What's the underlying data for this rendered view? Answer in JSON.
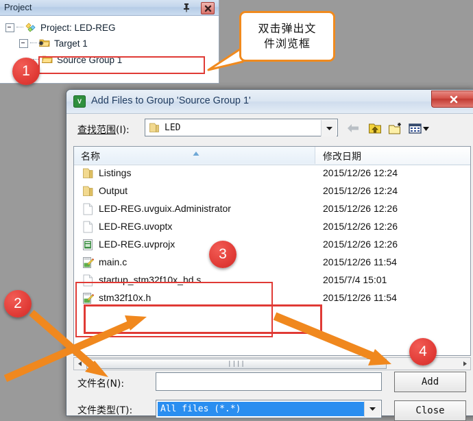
{
  "project_panel": {
    "title": "Project",
    "pin_icon": "pin-icon",
    "close_icon": "close-icon",
    "tree": [
      {
        "label": "Project: LED-REG",
        "icon": "project-icon",
        "expander": "minus"
      },
      {
        "label": "Target 1",
        "icon": "target-folder-icon",
        "expander": "minus"
      },
      {
        "label": "Source Group 1",
        "icon": "folder-icon",
        "expander": "none"
      }
    ]
  },
  "callout": {
    "text_line1": "双击弹出文",
    "text_line2": "件浏览框",
    "border_color": "#f08a1e"
  },
  "dialog": {
    "title": "Add Files to Group 'Source Group 1'",
    "app_icon": "uvision-icon",
    "close_icon": "close-icon",
    "lookin": {
      "label_main": "查找范围",
      "label_accel": "(I):",
      "value": "LED",
      "folder_icon": "folder-icon",
      "dropdown_icon": "chevron-down-icon"
    },
    "toolbar": [
      {
        "name": "back-button",
        "icon": "back-arrow-icon"
      },
      {
        "name": "up-folder-button",
        "icon": "up-folder-icon"
      },
      {
        "name": "new-folder-button",
        "icon": "new-folder-icon"
      },
      {
        "name": "views-button",
        "icon": "views-icon"
      }
    ],
    "list": {
      "columns": [
        "名称",
        "修改日期"
      ],
      "sort_indicator": "sort-asc-icon",
      "rows": [
        {
          "name": "Listings",
          "date": "2015/12/26 12:24",
          "icon": "folder-icon"
        },
        {
          "name": "Output",
          "date": "2015/12/26 12:24",
          "icon": "folder-icon"
        },
        {
          "name": "LED-REG.uvguix.Administrator",
          "date": "2015/12/26 12:26",
          "icon": "file-icon"
        },
        {
          "name": "LED-REG.uvoptx",
          "date": "2015/12/26 12:26",
          "icon": "file-icon"
        },
        {
          "name": "LED-REG.uvprojx",
          "date": "2015/12/26 12:26",
          "icon": "project-file-icon"
        },
        {
          "name": "main.c",
          "date": "2015/12/26 11:54",
          "icon": "source-file-icon"
        },
        {
          "name": "startup_stm32f10x_hd.s",
          "date": "2015/7/4 15:01",
          "icon": "file-icon"
        },
        {
          "name": "stm32f10x.h",
          "date": "2015/12/26 11:54",
          "icon": "source-file-icon"
        }
      ]
    },
    "hscroll": {
      "left_icon": "scroll-left-icon",
      "right_icon": "scroll-right-icon",
      "grip": "||||"
    },
    "filename": {
      "label_main": "文件名",
      "label_accel": "(N):",
      "value": "",
      "placeholder": ""
    },
    "filetype": {
      "label_main": "文件类型",
      "label_accel": "(T):",
      "value": "All files (*.*)",
      "dropdown_icon": "chevron-down-icon"
    },
    "buttons": {
      "add": "Add",
      "close": "Close"
    }
  },
  "annotations": {
    "badges": [
      "1",
      "2",
      "3",
      "4"
    ],
    "highlight_color": "#e03a35",
    "arrow_color": "#f0881e"
  }
}
